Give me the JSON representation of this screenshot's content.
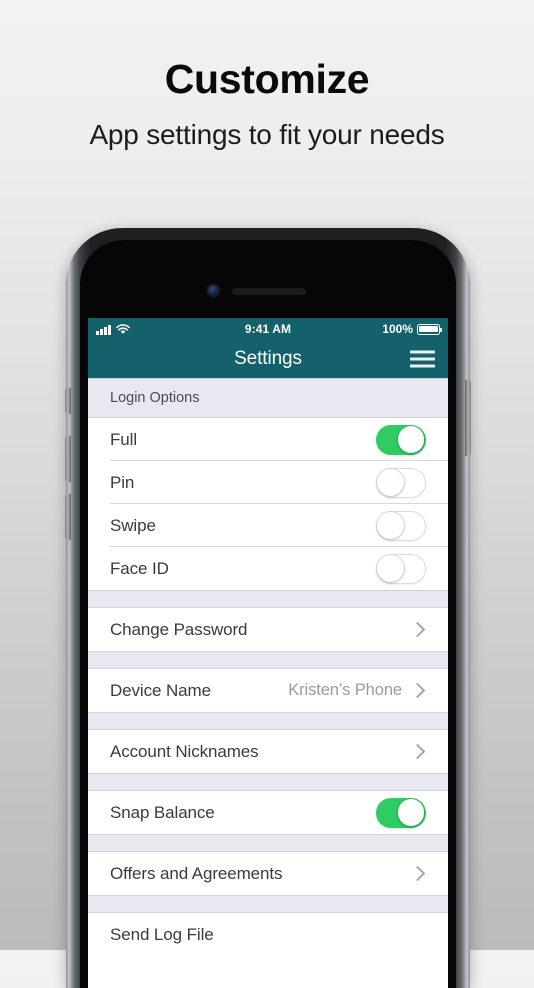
{
  "promo": {
    "title": "Customize",
    "subtitle": "App settings to fit your needs"
  },
  "colors": {
    "navbar_teal": "#14606B",
    "toggle_on_green": "#2ECC63",
    "section_band": "#E8E8F0",
    "page_bg_top": "#F2F2F2",
    "page_bg_bottom": "#BEBEBE"
  },
  "phone": {
    "status_bar": {
      "signal_icon": "cellular-signal-icon",
      "wifi_icon": "wifi-icon",
      "time": "9:41 AM",
      "battery_percent": "100%",
      "battery_icon": "battery-full-icon"
    },
    "nav_bar": {
      "title": "Settings",
      "menu_icon": "hamburger-menu-icon"
    },
    "sections": [
      {
        "header": "Login Options",
        "rows": [
          {
            "label": "Full",
            "type": "toggle",
            "toggle_state": "on"
          },
          {
            "label": "Pin",
            "type": "toggle",
            "toggle_state": "off"
          },
          {
            "label": "Swipe",
            "type": "toggle",
            "toggle_state": "off"
          },
          {
            "label": "Face ID",
            "type": "toggle",
            "toggle_state": "off"
          }
        ]
      },
      {
        "header": "",
        "rows": [
          {
            "label": "Change Password",
            "type": "chevron",
            "chevron_icon": "chevron-right-icon"
          }
        ]
      },
      {
        "header": "",
        "rows": [
          {
            "label": "Device Name",
            "type": "value-chevron",
            "value": "Kristen’s Phone",
            "chevron_icon": "chevron-right-icon"
          }
        ]
      },
      {
        "header": "",
        "rows": [
          {
            "label": "Account Nicknames",
            "type": "chevron",
            "chevron_icon": "chevron-right-icon"
          }
        ]
      },
      {
        "header": "",
        "rows": [
          {
            "label": "Snap Balance",
            "type": "toggle",
            "toggle_state": "on"
          }
        ]
      },
      {
        "header": "",
        "rows": [
          {
            "label": "Offers and Agreements",
            "type": "chevron",
            "chevron_icon": "chevron-right-icon"
          }
        ]
      },
      {
        "header": "",
        "rows": [
          {
            "label": "Send Log File",
            "type": "plain"
          }
        ]
      }
    ]
  }
}
